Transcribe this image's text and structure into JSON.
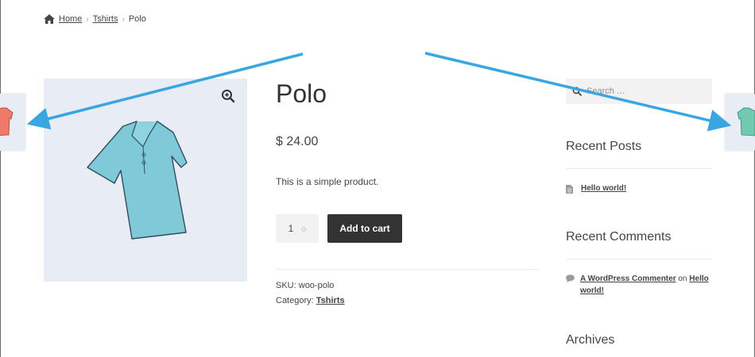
{
  "breadcrumb": {
    "home": "Home",
    "category": "Tshirts",
    "current": "Polo",
    "separator": "›"
  },
  "product": {
    "title": "Polo",
    "price": "$ 24.00",
    "description": "This is a simple product.",
    "quantity": "1",
    "add_to_cart_label": "Add to cart",
    "sku_label": "SKU:",
    "sku_value": "woo-polo",
    "category_label": "Category:",
    "category_value": "Tshirts",
    "shirt_color": "#7fc9d8"
  },
  "sidebar": {
    "search_placeholder": "Search …",
    "recent_posts_title": "Recent Posts",
    "recent_post": "Hello world!",
    "recent_comments_title": "Recent Comments",
    "comment_author": "A WordPress Commenter",
    "comment_on": "on",
    "comment_post_line1": "Hello",
    "comment_post_line2": "world!",
    "archives_title": "Archives"
  },
  "navigation": {
    "prev_thumb_color": "#f07a6a",
    "next_thumb_color": "#6fcab0"
  },
  "annotation": {
    "arrow_color": "#3aa6e0"
  }
}
